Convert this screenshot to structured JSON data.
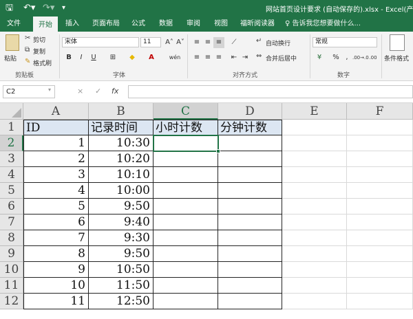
{
  "titlebar": {
    "save_icon": "save-icon",
    "undo_icon": "undo-icon",
    "redo_icon": "redo-icon",
    "customize_icon": "customize-qat-icon",
    "title": "网站首页设计要求 (自动保存的).xlsx - Excel(产品激活"
  },
  "tabs": [
    {
      "label": "文件"
    },
    {
      "label": "开始"
    },
    {
      "label": "插入"
    },
    {
      "label": "页面布局"
    },
    {
      "label": "公式"
    },
    {
      "label": "数据"
    },
    {
      "label": "审阅"
    },
    {
      "label": "视图"
    },
    {
      "label": "福昕阅读器"
    }
  ],
  "active_tab": "开始",
  "tell_me": "♀ 告诉我您想要做什么...",
  "ribbon": {
    "clipboard": {
      "paste": "粘贴",
      "cut": "剪切",
      "copy": "复制",
      "format_painter": "格式刷",
      "label": "剪贴板"
    },
    "font": {
      "font_name": "宋体",
      "font_size": "11",
      "bold": "B",
      "italic": "I",
      "underline": "U",
      "grow": "A˄",
      "shrink": "A˅",
      "phonetic": "wén",
      "label": "字体"
    },
    "alignment": {
      "wrap_text": "自动换行",
      "merge_center": "合并后居中",
      "label": "对齐方式"
    },
    "number": {
      "format": "常规",
      "percent": "%",
      "comma": ",",
      "increase_decimal": ".00→.0",
      "decrease_decimal": ".00",
      "label": "数字"
    },
    "styles": {
      "conditional_formatting": "条件格式"
    }
  },
  "formula_bar": {
    "name_box": "C2",
    "cancel": "×",
    "enter": "✓",
    "fx": "fx",
    "value": ""
  },
  "sheet": {
    "columns": [
      "A",
      "B",
      "C",
      "D",
      "E",
      "F"
    ],
    "selected_column": "C",
    "rows": [
      "1",
      "2",
      "3",
      "4",
      "5",
      "6",
      "7",
      "8",
      "9",
      "10",
      "11",
      "12"
    ],
    "selected_row": "2",
    "headers": [
      "ID",
      "记录时间",
      "小时计数",
      "分钟计数"
    ],
    "data": [
      {
        "id": "1",
        "time": "10:30"
      },
      {
        "id": "2",
        "time": "10:20"
      },
      {
        "id": "3",
        "time": "10:10"
      },
      {
        "id": "4",
        "time": "10:00"
      },
      {
        "id": "5",
        "time": "9:50"
      },
      {
        "id": "6",
        "time": "9:40"
      },
      {
        "id": "7",
        "time": "9:30"
      },
      {
        "id": "8",
        "time": "9:50"
      },
      {
        "id": "9",
        "time": "10:50"
      },
      {
        "id": "10",
        "time": "11:50"
      },
      {
        "id": "11",
        "time": "12:50"
      }
    ],
    "header_fill_color": "#dce6f2",
    "accent_color": "#217346"
  }
}
